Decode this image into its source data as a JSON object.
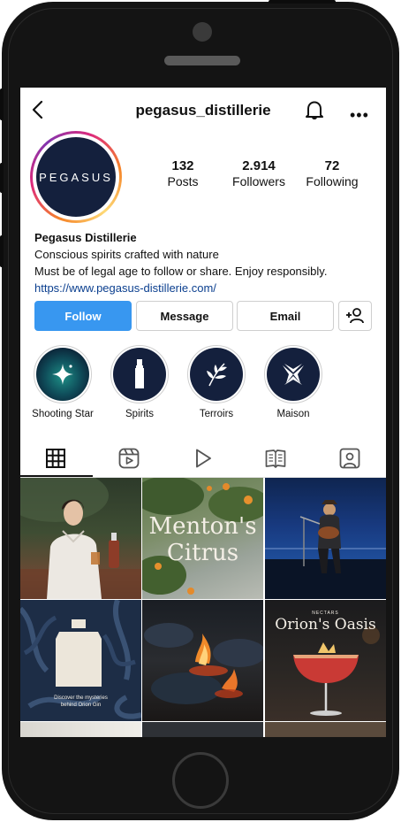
{
  "header": {
    "username": "pegasus_distillerie"
  },
  "profile": {
    "avatar_text": "PEGASUS",
    "stats": [
      {
        "value": "132",
        "label": "Posts"
      },
      {
        "value": "2.914",
        "label": "Followers"
      },
      {
        "value": "72",
        "label": "Following"
      }
    ],
    "name": "Pegasus Distillerie",
    "bio_line1": "Conscious spirits crafted with nature",
    "bio_line2": "Must be of legal age to follow or share. Enjoy responsibly.",
    "link": "https://www.pegasus-distillerie.com/"
  },
  "actions": {
    "follow": "Follow",
    "message": "Message",
    "email": "Email"
  },
  "highlights": [
    {
      "label": "Shooting Star",
      "icon": "sparkle-icon"
    },
    {
      "label": "Spirits",
      "icon": "bottle-icon"
    },
    {
      "label": "Terroirs",
      "icon": "leaf-icon"
    },
    {
      "label": "Maison",
      "icon": "pegasus-logo-icon"
    }
  ],
  "tabs": [
    "grid",
    "reels",
    "video",
    "guides",
    "tagged"
  ],
  "posts": {
    "p2_caption_line1": "Menton's",
    "p2_caption_line2": "Citrus",
    "p4_caption_line1": "Discover the mysteries",
    "p4_caption_line2": "behind Orion Gin",
    "p6_kicker": "NECTARS",
    "p6_caption": "Orion's Oasis"
  },
  "colors": {
    "follow_blue": "#3897f0",
    "brand_navy": "#14203d",
    "link": "#0b3f8f"
  }
}
